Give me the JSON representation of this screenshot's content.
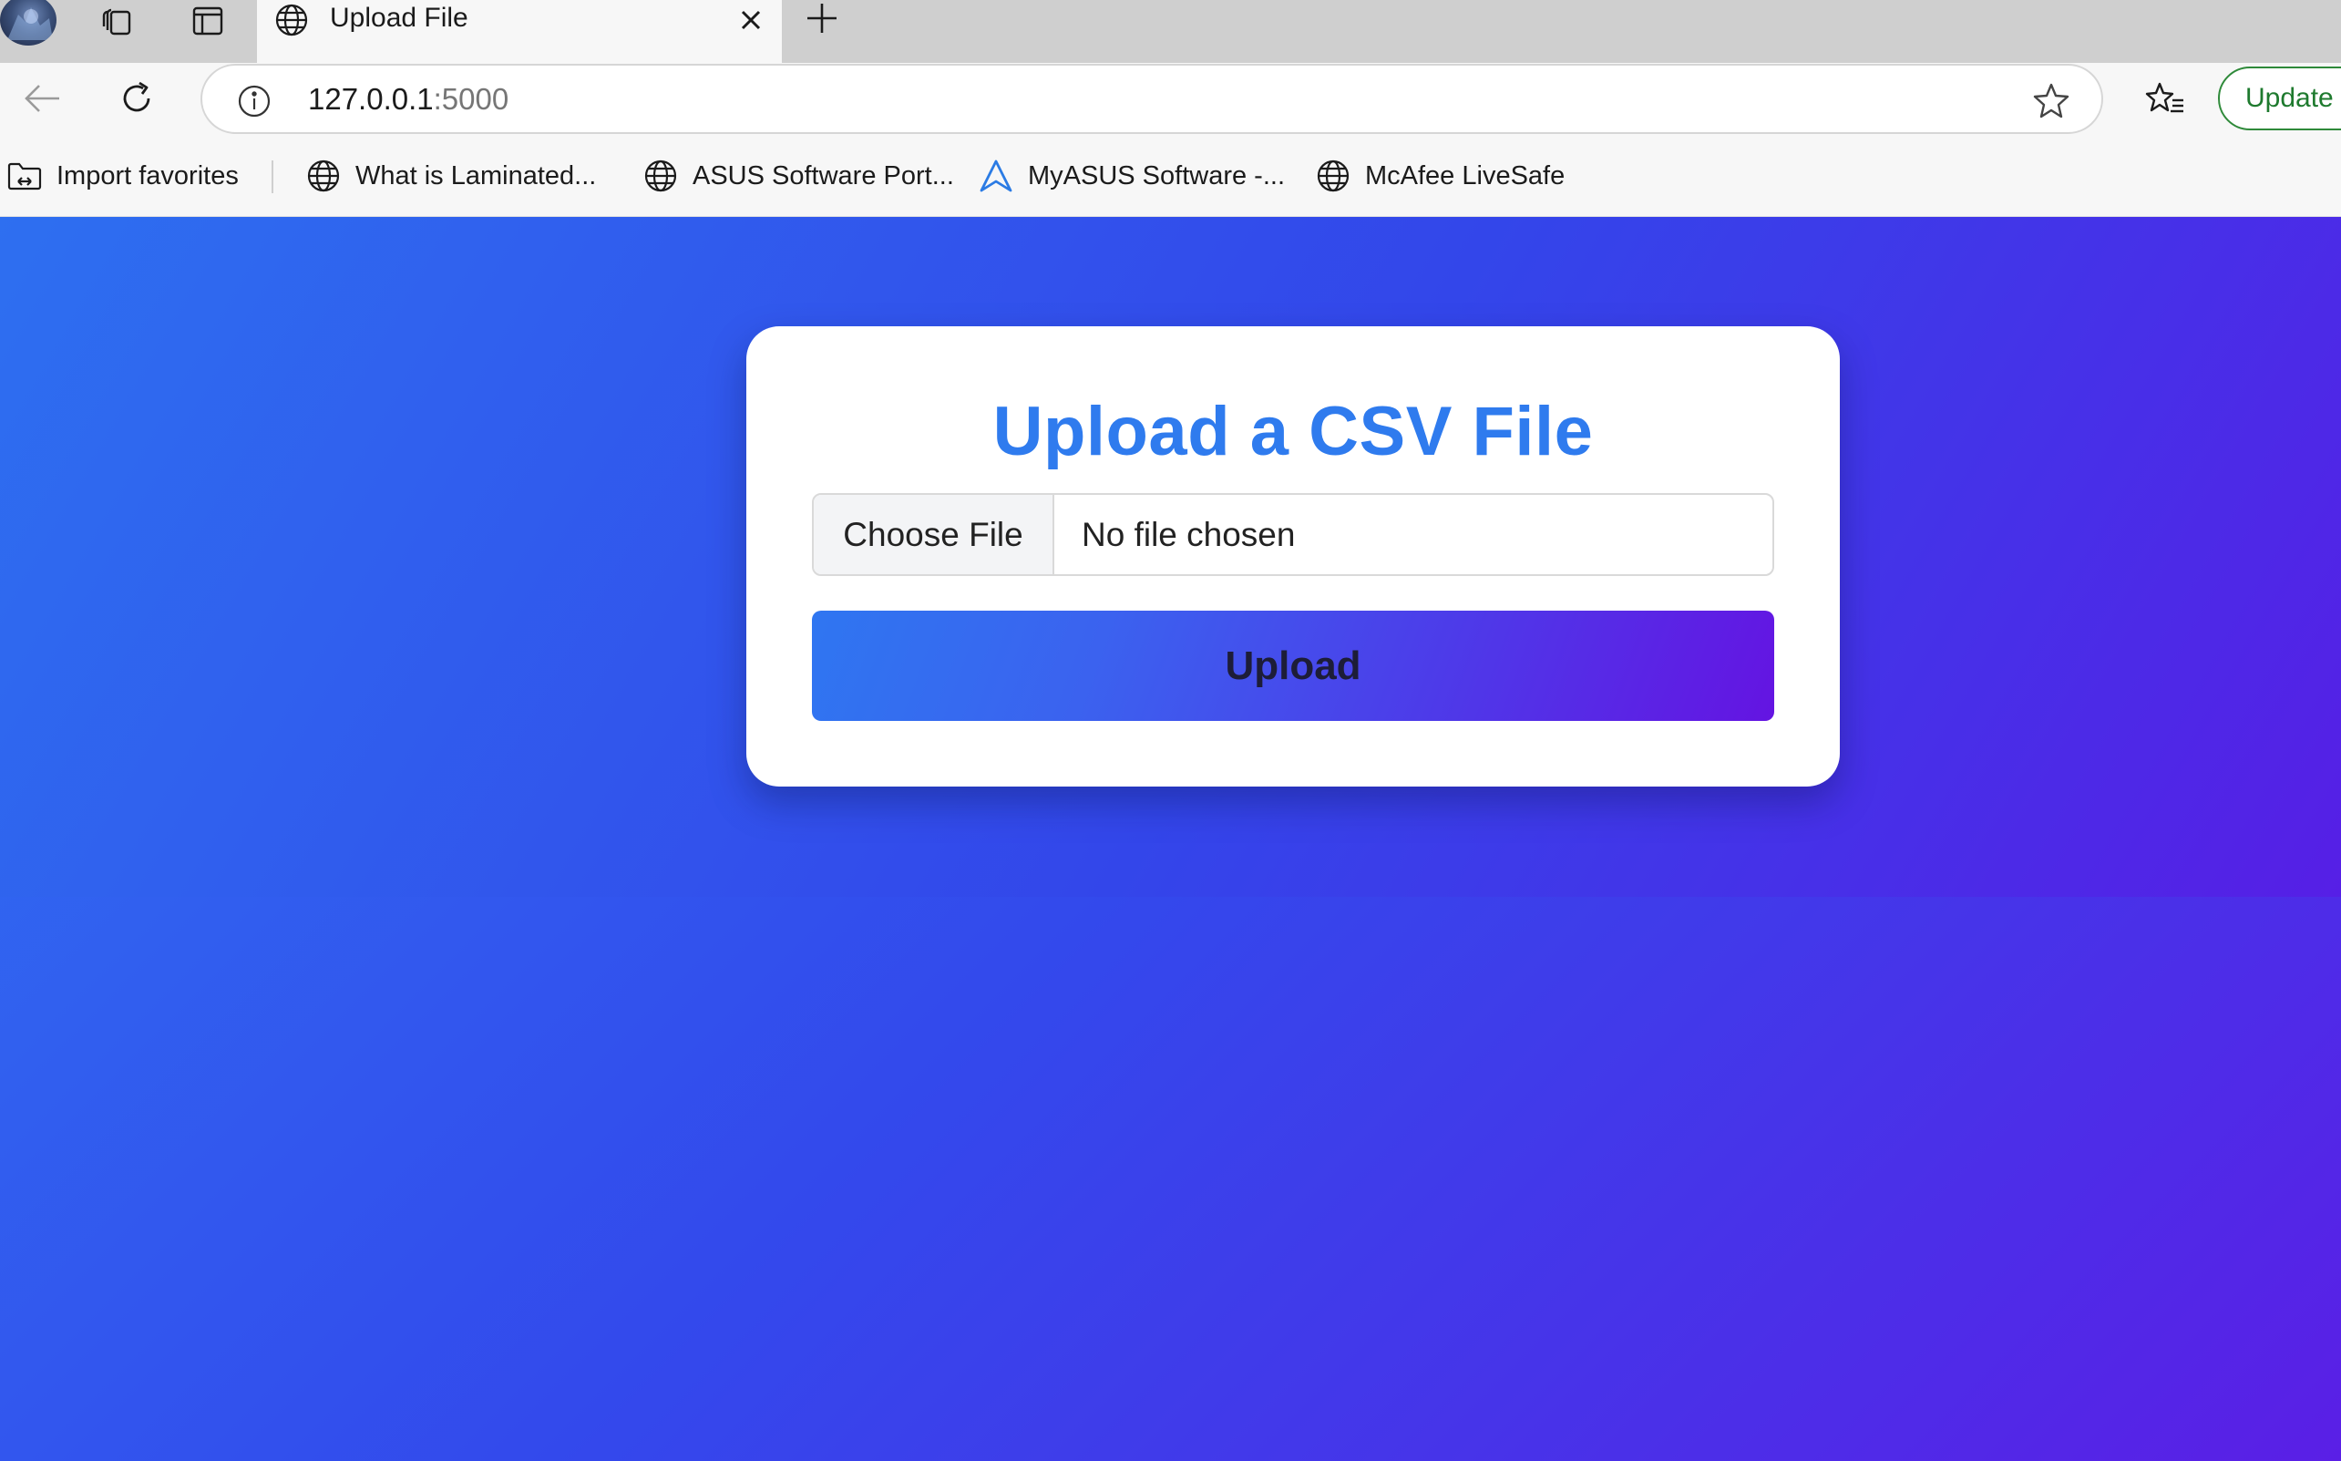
{
  "browser": {
    "tab": {
      "title": "Upload File"
    },
    "address_bar": {
      "host": "127.0.0.1",
      "port": ":5000"
    },
    "update_label": "Update",
    "favorites": [
      {
        "label": "Import favorites",
        "icon": "import-folder-icon"
      },
      {
        "label": "What is Laminated...",
        "icon": "globe-icon"
      },
      {
        "label": "ASUS Software Port...",
        "icon": "globe-icon"
      },
      {
        "label": "MyASUS Software -...",
        "icon": "myasus-icon"
      },
      {
        "label": "McAfee LiveSafe",
        "icon": "globe-icon"
      }
    ]
  },
  "page": {
    "title": "Upload a CSV File",
    "file_input": {
      "button_label": "Choose File",
      "status": "No file chosen"
    },
    "upload_label": "Upload",
    "colors": {
      "title": "#2f7bee",
      "gradient_start": "#2f74f2",
      "gradient_end": "#5a1fe6",
      "update_green": "#2f8a3a"
    }
  }
}
